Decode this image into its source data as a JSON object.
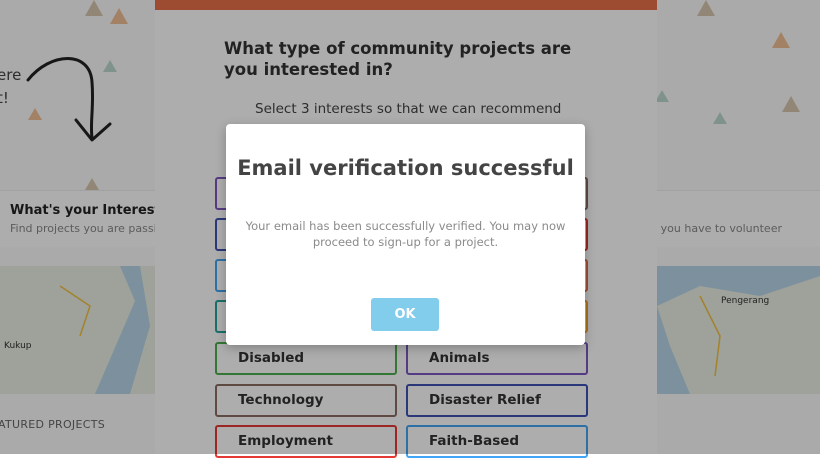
{
  "background": {
    "hero_text_line1": "ere",
    "hero_text_line2": "t!",
    "interest_title": "What's your Interest?",
    "interest_sub_left": "Find projects you are passio",
    "interest_sub_right": "ne you have to volunteer",
    "map_labels": [
      "Kukup",
      "Pengerang"
    ],
    "featured_label": "ATURED PROJECTS"
  },
  "interests_modal": {
    "title": "What type of community projects are you interested in?",
    "subtitle": "Select 3 interests so that we can recommend",
    "options": [
      {
        "label": "Disabled",
        "color": "#4caf50"
      },
      {
        "label": "Animals",
        "color": "#7e57c2"
      },
      {
        "label": "Technology",
        "color": "#8d6e63"
      },
      {
        "label": "Disaster Relief",
        "color": "#3f51b5"
      },
      {
        "label": "Employment",
        "color": "#e53935"
      },
      {
        "label": "Faith-Based",
        "color": "#42a5f5"
      }
    ]
  },
  "dialog": {
    "title": "Email verification successful",
    "message": "Your email has been successfully verified. You may now proceed to sign-up for a project.",
    "ok_label": "OK"
  },
  "colors": {
    "accent_top_bar": "#e8704a",
    "ok_button": "#82ccec"
  }
}
